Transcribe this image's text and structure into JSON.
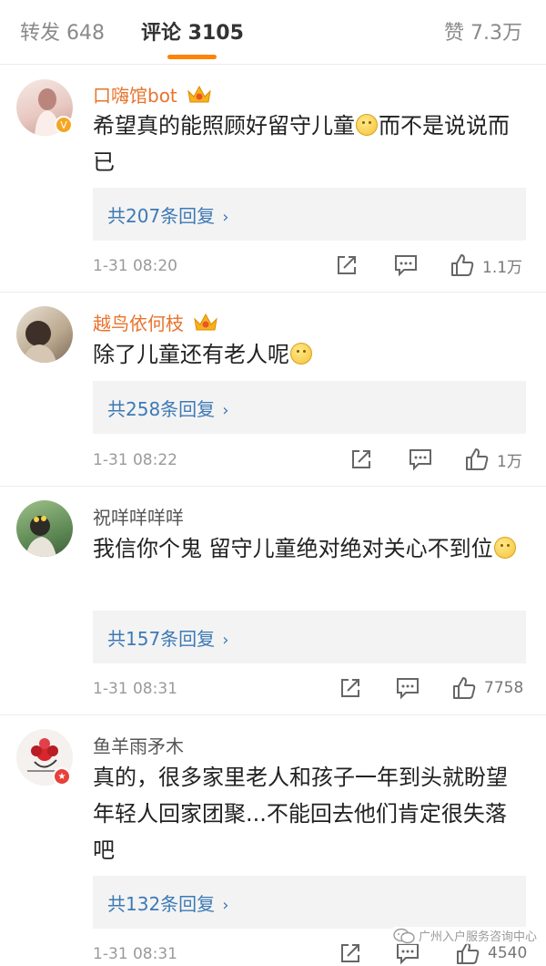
{
  "tabs": {
    "repost": "转发 648",
    "comment": "评论 3105",
    "like": "赞 7.3万"
  },
  "comments": [
    {
      "username": "口嗨馆bot",
      "text": "希望真的能照顾好留守儿童",
      "text_after": "而不是说说而已",
      "reply": "共207条回复",
      "time": "1-31 08:20",
      "likes": "1.1万"
    },
    {
      "username": "越鸟依何枝",
      "text": "除了儿童还有老人呢",
      "text_after": "",
      "reply": "共258条回复",
      "time": "1-31 08:22",
      "likes": "1万"
    },
    {
      "username": "祝咩咩咩咩",
      "text": "我信你个鬼  留守儿童绝对绝对关心不到位",
      "text_after": "",
      "reply": "共157条回复",
      "time": "1-31 08:31",
      "likes": "7758"
    },
    {
      "username": "鱼羊雨矛木",
      "text": "真的，很多家里老人和孩子一年到头就盼望年轻人回家团聚...不能回去他们肯定很失落吧",
      "text_after": "",
      "reply": "共132条回复",
      "time": "1-31 08:31",
      "likes": "4540"
    }
  ],
  "watermark": "广州入户服务咨询中心",
  "colors": {
    "accent": "#ff8200",
    "vip_name": "#e8732c",
    "link": "#3d7ab5"
  }
}
